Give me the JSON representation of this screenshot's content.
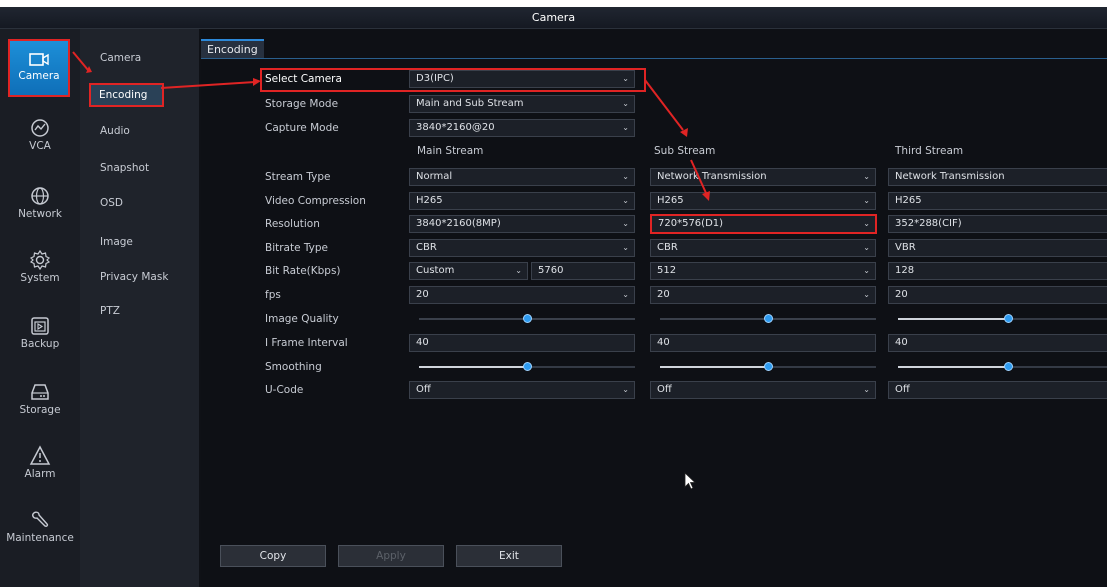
{
  "window": {
    "title": "Camera"
  },
  "nav": [
    {
      "key": "camera",
      "label": "Camera",
      "icon": "camera-icon"
    },
    {
      "key": "vca",
      "label": "VCA",
      "icon": "vca-icon"
    },
    {
      "key": "network",
      "label": "Network",
      "icon": "globe-icon"
    },
    {
      "key": "system",
      "label": "System",
      "icon": "gear-icon"
    },
    {
      "key": "backup",
      "label": "Backup",
      "icon": "backup-icon"
    },
    {
      "key": "storage",
      "label": "Storage",
      "icon": "hard-drive-icon"
    },
    {
      "key": "alarm",
      "label": "Alarm",
      "icon": "alarm-icon"
    },
    {
      "key": "maintenance",
      "label": "Maintenance",
      "icon": "wrench-icon"
    }
  ],
  "submenu": [
    {
      "label": "Camera"
    },
    {
      "label": "Encoding"
    },
    {
      "label": "Audio"
    },
    {
      "label": "Snapshot"
    },
    {
      "label": "OSD"
    },
    {
      "label": "Image"
    },
    {
      "label": "Privacy Mask"
    },
    {
      "label": "PTZ"
    }
  ],
  "tab": {
    "label": "Encoding"
  },
  "form": {
    "select_camera": {
      "label": "Select Camera",
      "value": "D3(IPC)"
    },
    "storage_mode": {
      "label": "Storage Mode",
      "value": "Main and Sub Stream"
    },
    "capture_mode": {
      "label": "Capture Mode",
      "value": "3840*2160@20"
    }
  },
  "streams": {
    "headers": [
      "Main Stream",
      "Sub Stream",
      "Third Stream"
    ],
    "labels": {
      "stream_type": "Stream Type",
      "video_compression": "Video Compression",
      "resolution": "Resolution",
      "bitrate_type": "Bitrate Type",
      "bit_rate": "Bit Rate(Kbps)",
      "fps": "fps",
      "image_quality": "Image Quality",
      "i_frame_interval": "I Frame Interval",
      "smoothing": "Smoothing",
      "u_code": "U-Code"
    },
    "main": {
      "stream_type": "Normal",
      "video_compression": "H265",
      "resolution": "3840*2160(8MP)",
      "bitrate_type": "CBR",
      "bit_rate_mode": "Custom",
      "bit_rate": "5760",
      "fps": "20",
      "image_quality_level": 0.5,
      "i_frame_interval": "40",
      "smoothing_level": 0.5,
      "u_code": "Off"
    },
    "sub": {
      "stream_type": "Network Transmission",
      "video_compression": "H265",
      "resolution": "720*576(D1)",
      "bitrate_type": "CBR",
      "bit_rate": "512",
      "fps": "20",
      "image_quality_level": 0.5,
      "i_frame_interval": "40",
      "smoothing_level": 0.5,
      "u_code": "Off"
    },
    "third": {
      "stream_type": "Network Transmission",
      "video_compression": "H265",
      "resolution": "352*288(CIF)",
      "bitrate_type": "VBR",
      "bit_rate": "128",
      "fps": "20",
      "image_quality_level": 0.5,
      "i_frame_interval": "40",
      "smoothing_level": 0.5,
      "u_code": "Off"
    }
  },
  "buttons": {
    "copy": "Copy",
    "apply": "Apply",
    "exit": "Exit"
  },
  "colors": {
    "accent": "#1d8fd8",
    "highlight": "#e02424",
    "background": "#0e1015"
  }
}
